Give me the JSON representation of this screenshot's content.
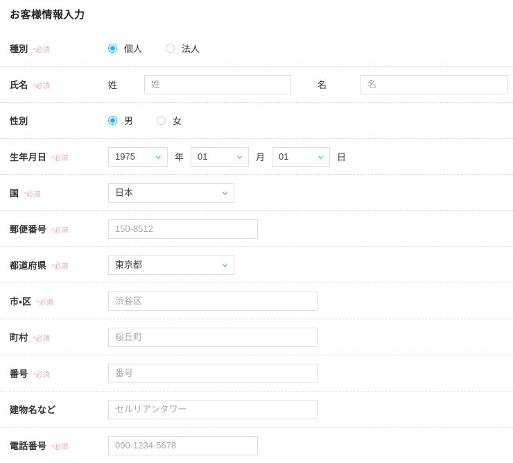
{
  "page": {
    "title": "お客様情報入力",
    "required_marker": "必須",
    "required_star": "*",
    "accent_color": "#26b3e8",
    "required_color": "#e8a6ae",
    "border_color": "#dddddd",
    "divider_color": "#d8d8d8"
  },
  "rows": {
    "type": {
      "label": "種別",
      "required": true,
      "options": [
        {
          "label": "個人",
          "selected": true
        },
        {
          "label": "法人",
          "selected": false
        }
      ]
    },
    "name": {
      "label": "氏名",
      "required": true,
      "last_name": {
        "sub_label": "姓",
        "value": "",
        "placeholder": "姓"
      },
      "first_name": {
        "sub_label": "名",
        "value": "",
        "placeholder": "名"
      }
    },
    "gender": {
      "label": "性別",
      "required": false,
      "options": [
        {
          "label": "男",
          "selected": true
        },
        {
          "label": "女",
          "selected": false
        }
      ]
    },
    "birthday": {
      "label": "生年月日",
      "required": true,
      "year": {
        "value": "1975",
        "unit": "年"
      },
      "month": {
        "value": "01",
        "unit": "月"
      },
      "day": {
        "value": "01",
        "unit": "日"
      }
    },
    "country": {
      "label": "国",
      "required": true,
      "value": "日本"
    },
    "postal": {
      "label": "郵便番号",
      "required": true,
      "value": "",
      "placeholder": "150-8512"
    },
    "prefecture": {
      "label": "都道府県",
      "required": true,
      "value": "東京都"
    },
    "city": {
      "label": "市・区",
      "required": true,
      "value": "",
      "placeholder": "渋谷区"
    },
    "town": {
      "label": "町村",
      "required": true,
      "value": "",
      "placeholder": "桜丘町"
    },
    "banchi": {
      "label": "番号",
      "required": true,
      "value": "",
      "placeholder": "番号"
    },
    "building": {
      "label": "建物名など",
      "required": false,
      "value": "",
      "placeholder": "セルリアンタワー"
    },
    "tel": {
      "label": "電話番号",
      "required": true,
      "value": "",
      "placeholder": "090-1234-5678"
    }
  }
}
